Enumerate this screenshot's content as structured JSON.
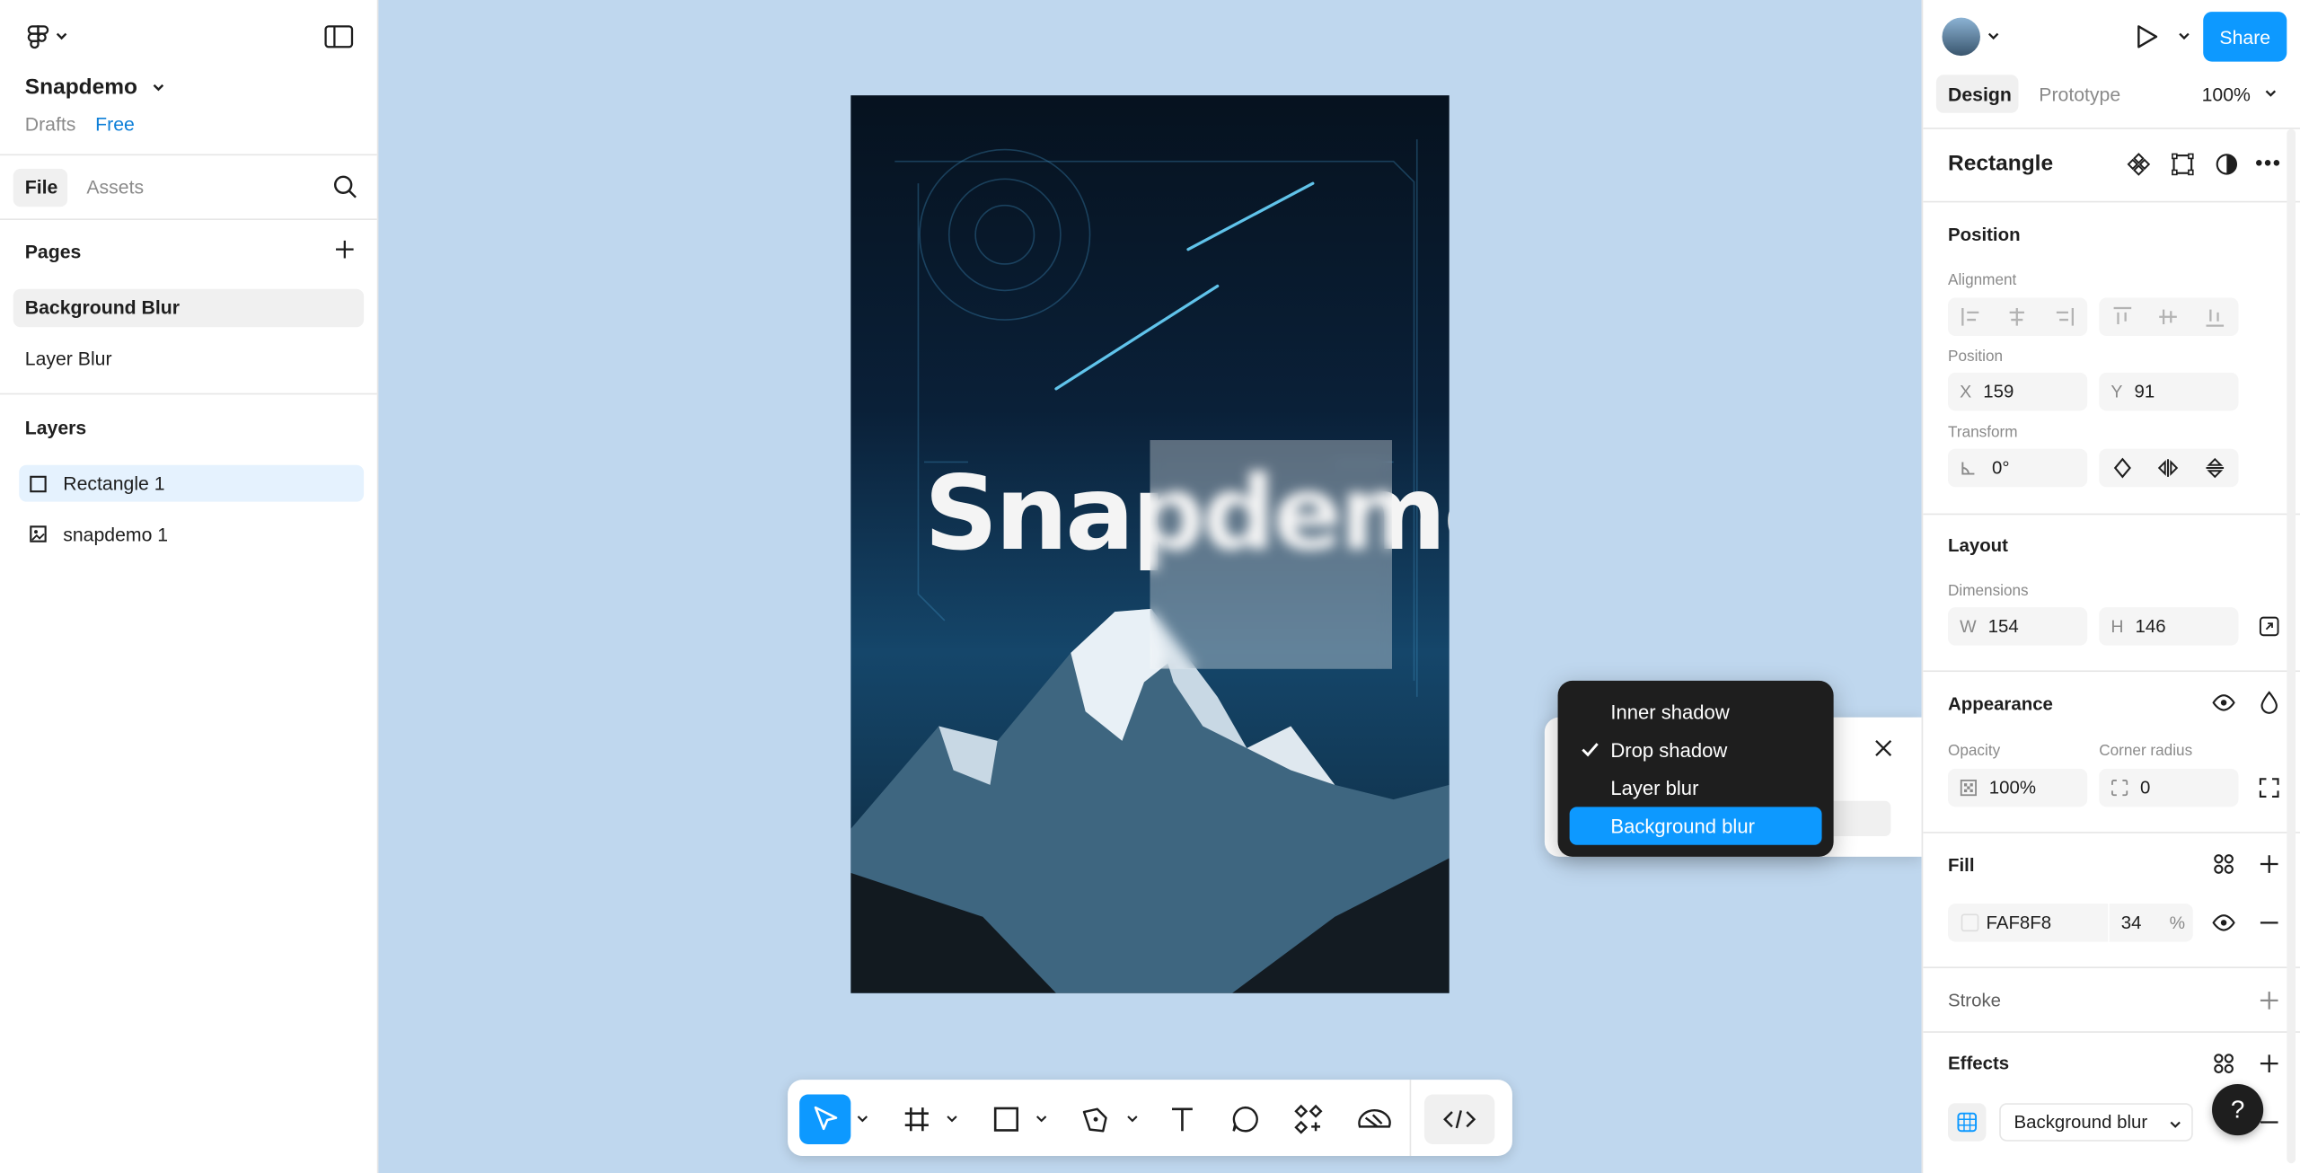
{
  "file": {
    "name": "Snapdemo",
    "location": "Drafts",
    "plan": "Free"
  },
  "leftTabs": {
    "file": "File",
    "assets": "Assets"
  },
  "pages": {
    "title": "Pages",
    "items": [
      "Background Blur",
      "Layer Blur"
    ]
  },
  "layers": {
    "title": "Layers",
    "items": [
      "Rectangle 1",
      "snapdemo 1"
    ]
  },
  "canvas": {
    "artText": "Snapdemo"
  },
  "header": {
    "share": "Share",
    "zoom": "100%",
    "tabs": [
      "Design",
      "Prototype"
    ]
  },
  "panel": {
    "title": "Rectangle",
    "position": {
      "title": "Position",
      "alignment": "Alignment",
      "positionLabel": "Position",
      "x_label": "X",
      "x": "159",
      "y_label": "Y",
      "y": "91",
      "transform": "Transform",
      "rotation": "0°"
    },
    "layout": {
      "title": "Layout",
      "dimensions": "Dimensions",
      "w_label": "W",
      "w": "154",
      "h_label": "H",
      "h": "146"
    },
    "appearance": {
      "title": "Appearance",
      "opacity_label": "Opacity",
      "opacity": "100%",
      "radius_label": "Corner radius",
      "radius": "0"
    },
    "fill": {
      "title": "Fill",
      "hex": "FAF8F8",
      "opacity": "34",
      "unit": "%"
    },
    "stroke": {
      "title": "Stroke"
    },
    "effects": {
      "title": "Effects",
      "type": "Background blur"
    }
  },
  "effectMenu": {
    "items": [
      "Inner shadow",
      "Drop shadow",
      "Layer blur",
      "Background blur"
    ],
    "checked": "Drop shadow",
    "highlighted": "Background blur"
  },
  "help": "?"
}
